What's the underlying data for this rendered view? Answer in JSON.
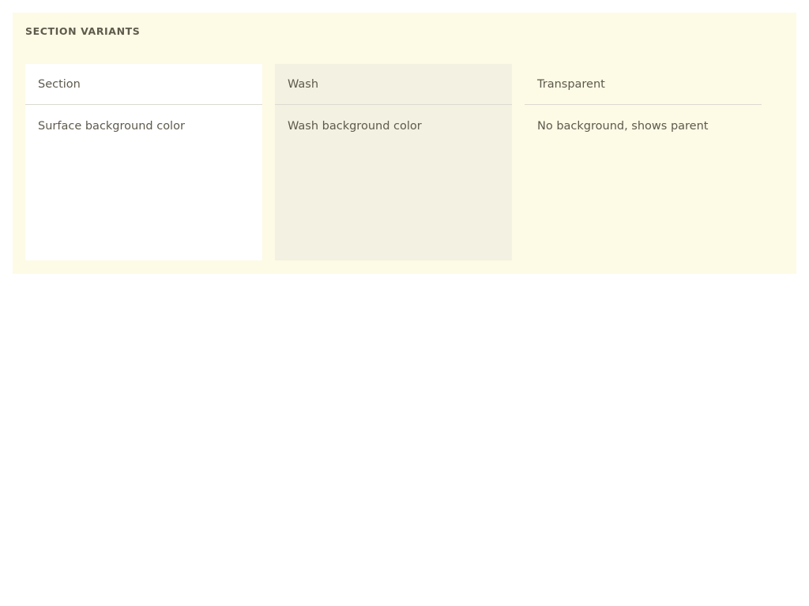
{
  "panel": {
    "title": "SECTION VARIANTS"
  },
  "variants": [
    {
      "header": "Section",
      "body": "Surface background color"
    },
    {
      "header": "Wash",
      "body": "Wash background color"
    },
    {
      "header": "Transparent",
      "body": "No background, shows parent"
    }
  ],
  "colors": {
    "page_background": "#ffffff",
    "panel_background": "#fdfae6",
    "surface": "#ffffff",
    "wash": "#f3f1e1",
    "divider": "#dcdad0",
    "text": "#5e5a4d"
  }
}
